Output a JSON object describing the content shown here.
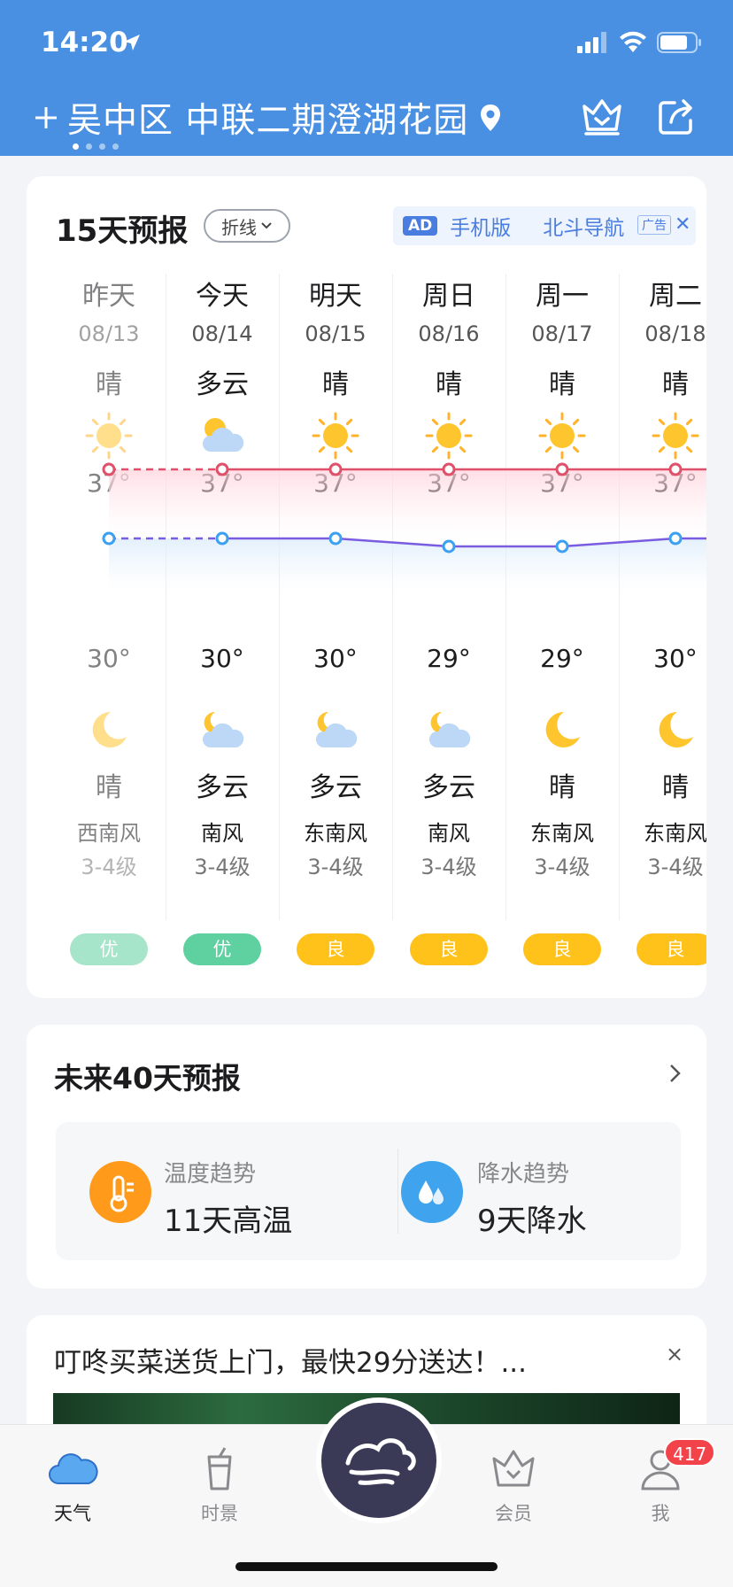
{
  "status": {
    "time": "14:20"
  },
  "header": {
    "location": "吴中区 中联二期澄湖花园"
  },
  "forecast15": {
    "title": "15天预报",
    "mode": "折线",
    "ad": {
      "tag": "AD",
      "text1": "手机版",
      "text2": "北斗导航",
      "label": "广告",
      "close": "✕"
    },
    "days": [
      {
        "day": "昨天",
        "date": "08/13",
        "day_cond": "晴",
        "day_icon": "sun-icon",
        "high": "37°",
        "low": "30°",
        "night_icon": "moon-icon",
        "night_cond": "晴",
        "wind": "西南风",
        "level": "3-4级",
        "aqi": "优",
        "aqi_color": "#5fd0a0",
        "past": true
      },
      {
        "day": "今天",
        "date": "08/14",
        "day_cond": "多云",
        "day_icon": "partly-cloudy-icon",
        "high": "37°",
        "low": "30°",
        "night_icon": "cloudy-night-icon",
        "night_cond": "多云",
        "wind": "南风",
        "level": "3-4级",
        "aqi": "优",
        "aqi_color": "#5fd0a0",
        "past": false
      },
      {
        "day": "明天",
        "date": "08/15",
        "day_cond": "晴",
        "day_icon": "sun-icon",
        "high": "37°",
        "low": "30°",
        "night_icon": "cloudy-night-icon",
        "night_cond": "多云",
        "wind": "东南风",
        "level": "3-4级",
        "aqi": "良",
        "aqi_color": "#ffc21b",
        "past": false
      },
      {
        "day": "周日",
        "date": "08/16",
        "day_cond": "晴",
        "day_icon": "sun-icon",
        "high": "37°",
        "low": "29°",
        "night_icon": "cloudy-night-icon",
        "night_cond": "多云",
        "wind": "南风",
        "level": "3-4级",
        "aqi": "良",
        "aqi_color": "#ffc21b",
        "past": false
      },
      {
        "day": "周一",
        "date": "08/17",
        "day_cond": "晴",
        "day_icon": "sun-icon",
        "high": "37°",
        "low": "29°",
        "night_icon": "moon-icon",
        "night_cond": "晴",
        "wind": "东南风",
        "level": "3-4级",
        "aqi": "良",
        "aqi_color": "#ffc21b",
        "past": false
      },
      {
        "day": "周二",
        "date": "08/18",
        "day_cond": "晴",
        "day_icon": "sun-icon",
        "high": "37°",
        "low": "30°",
        "night_icon": "moon-icon",
        "night_cond": "晴",
        "wind": "东南风",
        "level": "3-4级",
        "aqi": "良",
        "aqi_color": "#ffc21b",
        "past": false
      }
    ],
    "colors": {
      "high_line": "#e0506a",
      "low_line": "#7a5ce0",
      "low_dot": "#3ba0ef"
    }
  },
  "forecast40": {
    "title": "未来40天预报",
    "temp": {
      "label": "温度趋势",
      "value": "11天高温",
      "icon": "thermometer-icon",
      "color": "#ff9a1a"
    },
    "rain": {
      "label": "降水趋势",
      "value": "9天降水",
      "icon": "raindrop-icon",
      "color": "#3fa3ee"
    }
  },
  "ad_card": {
    "headline": "叮咚买菜送货上门，最快29分送达！...",
    "close": "×"
  },
  "tabbar": {
    "tabs": [
      {
        "label": "天气",
        "icon": "cloud-icon",
        "active": true
      },
      {
        "label": "时景",
        "icon": "cup-icon",
        "active": false
      },
      {
        "label": "会员",
        "icon": "crown-icon",
        "active": false
      },
      {
        "label": "我",
        "icon": "user-icon",
        "active": false
      }
    ],
    "badge": "417"
  }
}
